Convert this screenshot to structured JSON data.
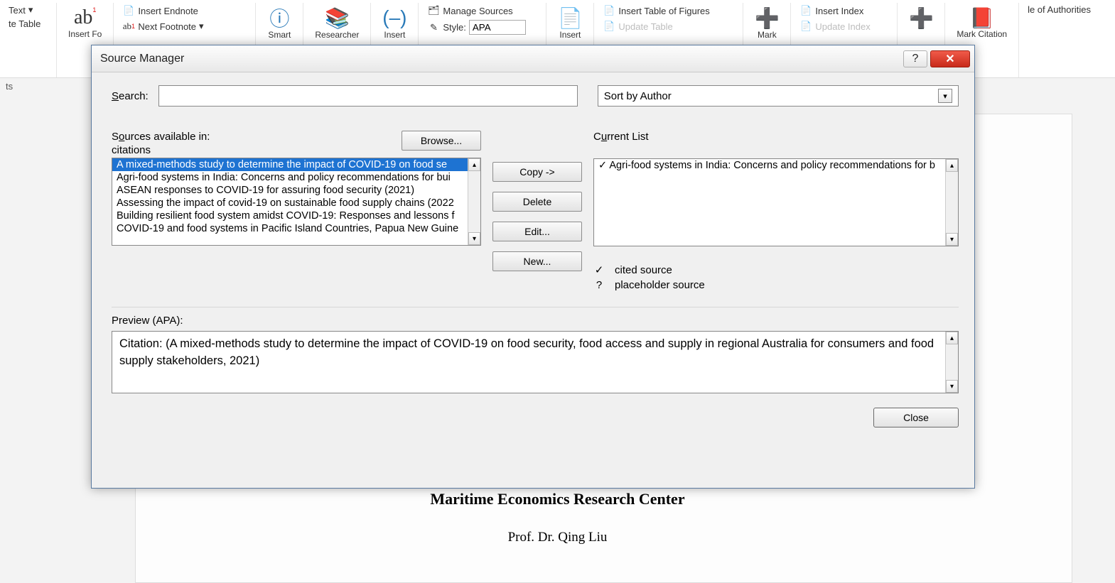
{
  "ribbon": {
    "text_dropdown": "Text",
    "te_table": "te Table",
    "ab_label": "ab",
    "insert_fo": "Insert\nFo",
    "insert_endnote": "Insert Endnote",
    "next_footnote": "Next Footnote",
    "smart": "Smart",
    "researcher": "Researcher",
    "insert_trunc": "Insert",
    "manage_sources": "Manage Sources",
    "style_label": "Style:",
    "style_value": "APA",
    "insert_trunc2": "Insert",
    "insert_tof": "Insert Table of Figures",
    "update_table": "Update Table",
    "mark": "Mark",
    "insert_index": "Insert Index",
    "update_index": "Update Index",
    "mark_citation": "Mark\nCitation",
    "le_of_auth": "le of Authorities",
    "ts": "ts"
  },
  "dialog": {
    "title": "Source Manager",
    "search_label": "Search:",
    "search_value": "",
    "sort_value": "Sort by Author",
    "sources_avail_label": "Sources available in:",
    "sources_location": "citations",
    "browse_label": "Browse...",
    "current_list_label": "Current List",
    "master_list": [
      "A mixed-methods study to determine the impact of COVID-19 on food se",
      "Agri-food systems in India: Concerns and policy recommendations for bui",
      "ASEAN responses to COVID-19 for assuring food security (2021)",
      "Assessing the impact of covid-19 on sustainable food supply chains (2022",
      "Building resilient food system amidst COVID-19: Responses and lessons f",
      "COVID-19 and food systems in Pacific Island Countries, Papua New Guine"
    ],
    "current_list": [
      "✓ Agri-food systems in India: Concerns and policy recommendations for b"
    ],
    "buttons": {
      "copy": "Copy ->",
      "delete": "Delete",
      "edit": "Edit...",
      "new": "New..."
    },
    "legend_cited": "cited source",
    "legend_placeholder": "placeholder source",
    "preview_label": "Preview (APA):",
    "preview_text": "Citation:  (A mixed-methods study to determine the impact of COVID-19 on food security, food access and supply in regional Australia for consumers and food supply stakeholders, 2021)",
    "close_label": "Close"
  },
  "document": {
    "heading": "Maritime Economics Research Center",
    "author": "Prof. Dr. Qing Liu"
  }
}
